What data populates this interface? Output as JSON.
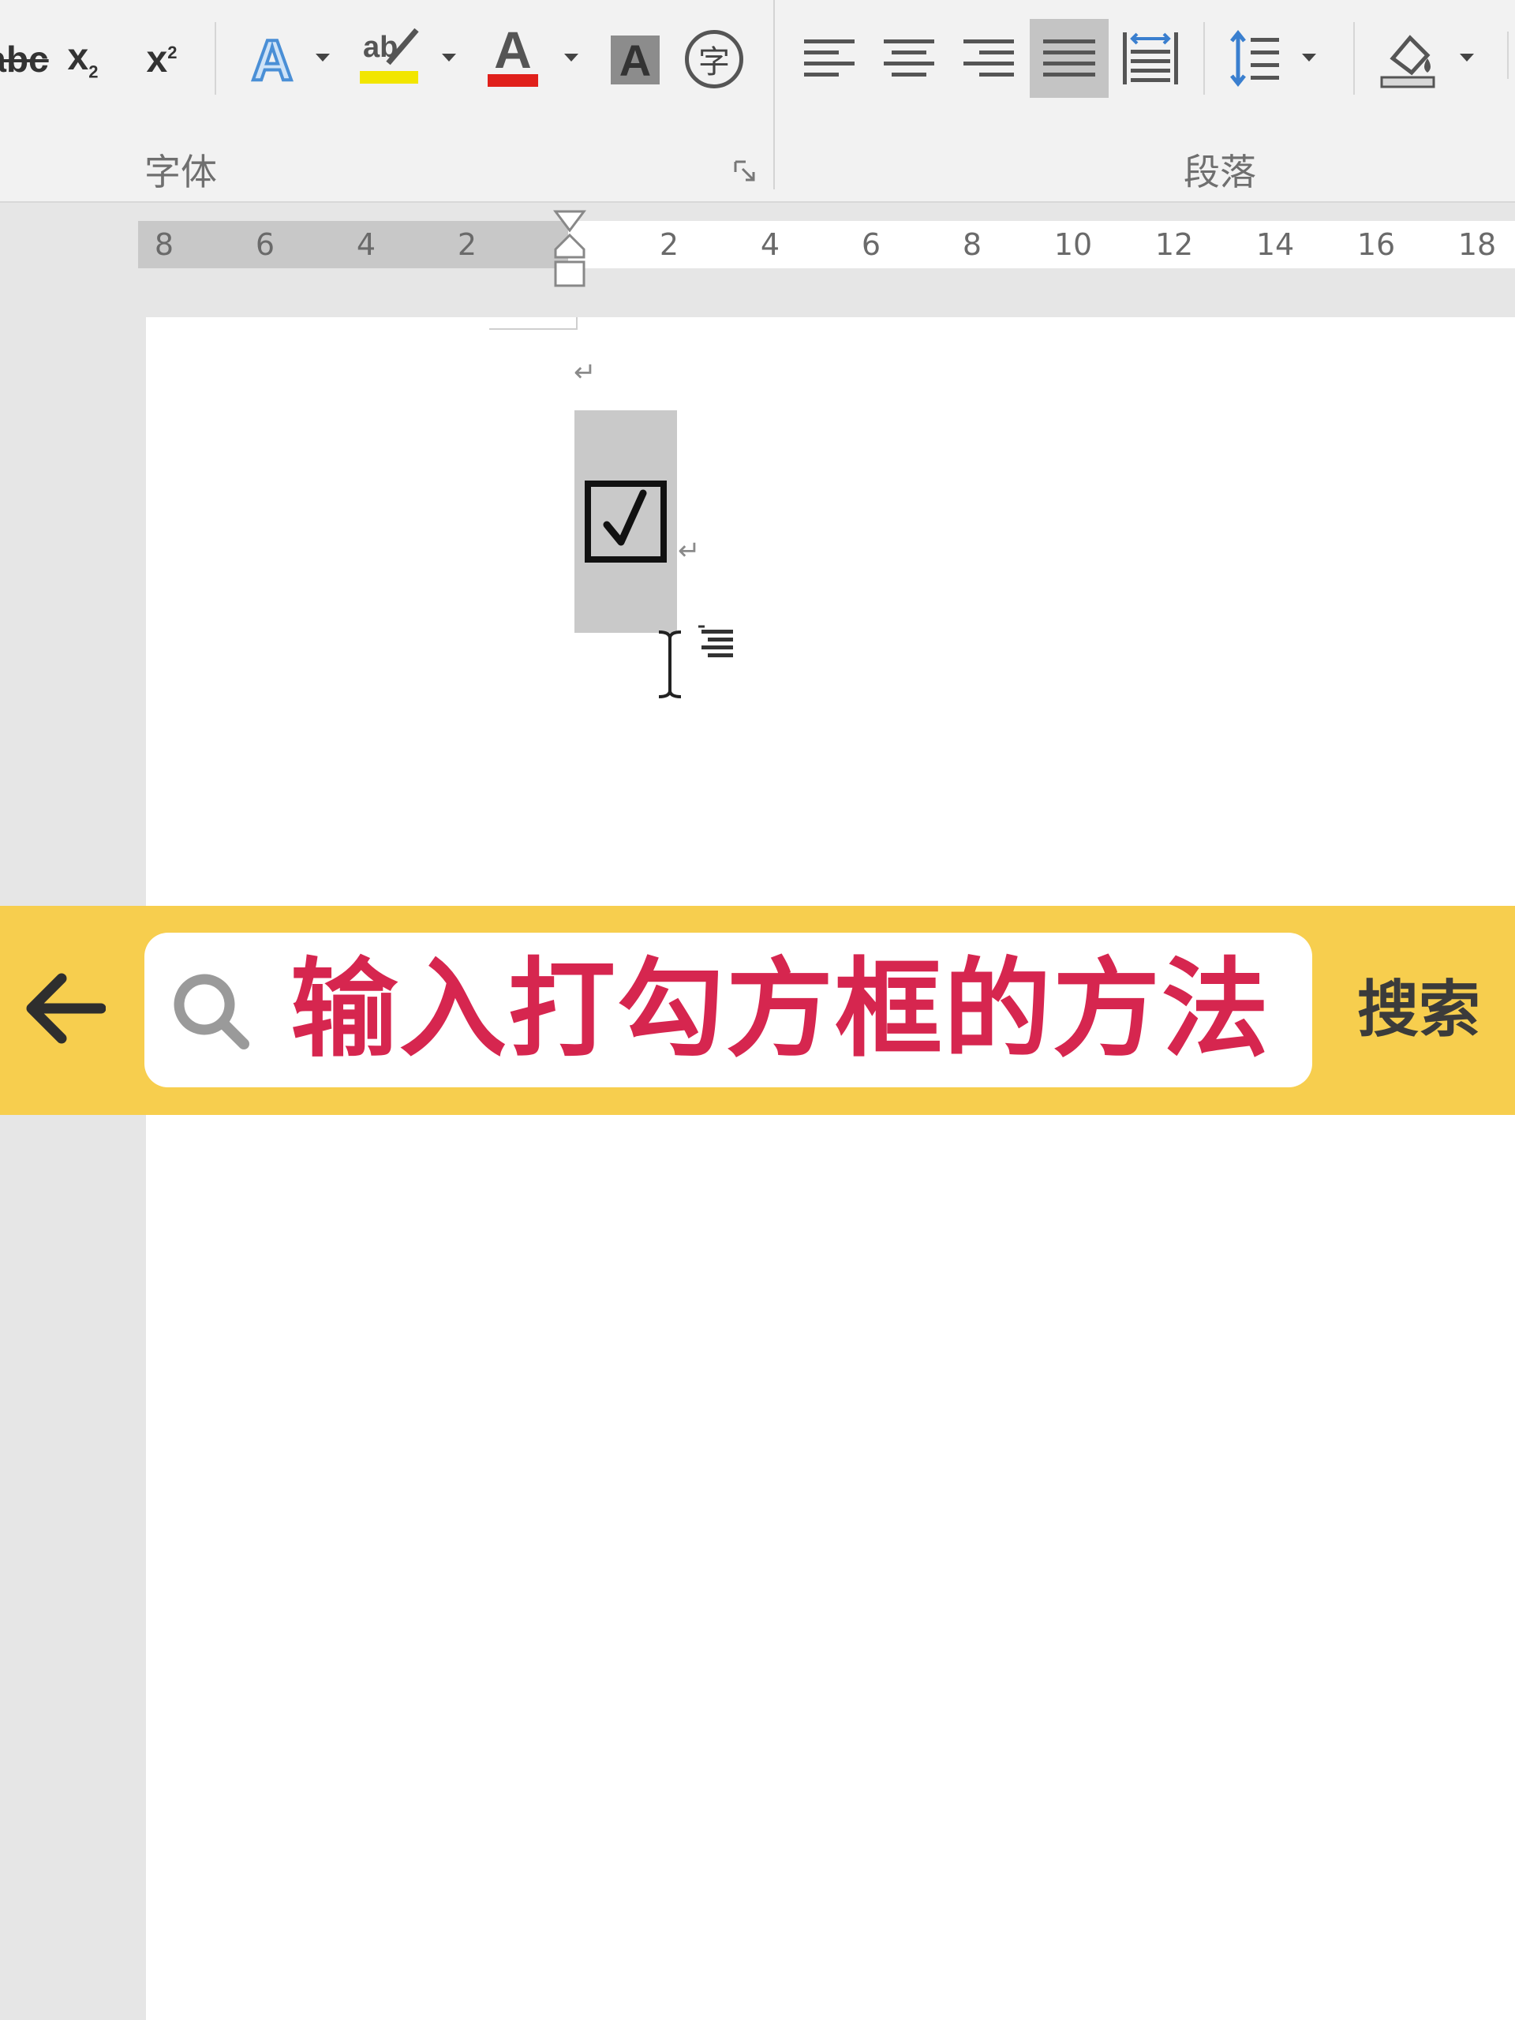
{
  "ribbon": {
    "font_group": {
      "label": "字体",
      "tools": [
        {
          "name": "strikethrough-icon",
          "glyph": "abc"
        },
        {
          "name": "subscript-icon",
          "glyph": "x₂"
        },
        {
          "name": "superscript-icon",
          "glyph": "x²"
        },
        {
          "name": "text-effects-icon",
          "glyph": "A"
        },
        {
          "name": "highlight-icon",
          "glyph": "ab"
        },
        {
          "name": "font-color-icon",
          "glyph": "A"
        },
        {
          "name": "character-shading-icon",
          "glyph": "A"
        },
        {
          "name": "enclose-characters-icon",
          "glyph": "字"
        }
      ],
      "colors": {
        "highlight": "#f2e600",
        "font_color": "#e0201b",
        "text_effects": "#4a8fd6"
      }
    },
    "paragraph_group": {
      "label": "段落",
      "tools": [
        "align-left-icon",
        "align-center-icon",
        "align-right-icon",
        "justify-icon",
        "distributed-icon",
        "line-spacing-icon",
        "shading-icon"
      ],
      "active_tool": "justify-icon"
    }
  },
  "ruler": {
    "left_ticks": [
      "8",
      "6",
      "4",
      "2"
    ],
    "right_ticks": [
      "2",
      "4",
      "6",
      "8",
      "10",
      "12",
      "14",
      "16",
      "18"
    ]
  },
  "document": {
    "paragraph_mark": "↵",
    "checkbox_symbol": "☑",
    "checked": true
  },
  "search": {
    "query": "输入打勾方框的方法",
    "submit_label": "搜索",
    "query_color": "#d6264f",
    "bar_color": "#f7ce4e"
  }
}
